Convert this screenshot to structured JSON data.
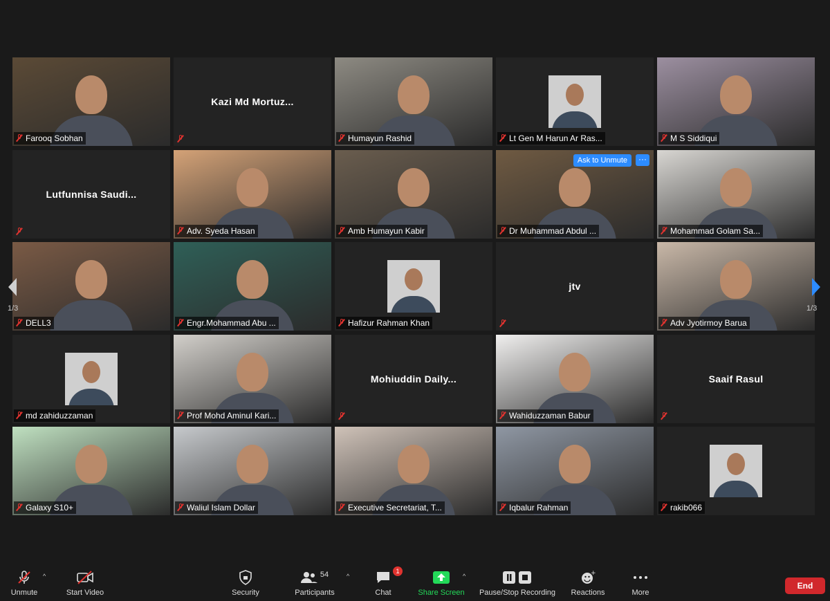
{
  "tiles": [
    {
      "name": "Farooq Sobhan",
      "type": "video",
      "bg": "#5b4a36"
    },
    {
      "name": "Kazi Md Mortuz...",
      "type": "name-only"
    },
    {
      "name": "Humayun Rashid",
      "type": "video",
      "bg": "#8d8a82"
    },
    {
      "name": "Lt Gen M Harun Ar Ras...",
      "type": "photo"
    },
    {
      "name": "M S Siddiqui",
      "type": "video",
      "bg": "#9c8fa0"
    },
    {
      "name": "Lutfunnisa Saudi...",
      "type": "name-only"
    },
    {
      "name": "Adv. Syeda Hasan",
      "type": "video",
      "bg": "#d4a277"
    },
    {
      "name": "Amb Humayun Kabir",
      "type": "video",
      "bg": "#6a5d4e"
    },
    {
      "name": "Dr Muhammad Abdul ...",
      "type": "video",
      "bg": "#6f5a42"
    },
    {
      "name": "Mohammad Golam Sa...",
      "type": "video",
      "bg": "#d8d6d2"
    },
    {
      "name": "DELL3",
      "type": "video",
      "bg": "#7a5a45"
    },
    {
      "name": "Engr.Mohammad Abu ...",
      "type": "video",
      "bg": "#2f5f57"
    },
    {
      "name": "Hafizur Rahman Khan",
      "type": "photo"
    },
    {
      "name": "jtv",
      "type": "name-only"
    },
    {
      "name": "Adv Jyotirmoy Barua",
      "type": "video",
      "bg": "#c9b8a8"
    },
    {
      "name": "md zahiduzzaman",
      "type": "photo"
    },
    {
      "name": "Prof Mohd Aminul Kari...",
      "type": "video",
      "bg": "#d2cfca"
    },
    {
      "name": "Mohiuddin Daily...",
      "type": "name-only"
    },
    {
      "name": "Wahiduzzaman Babur",
      "type": "video",
      "bg": "#f0efee"
    },
    {
      "name": "Saaif Rasul",
      "type": "name-only"
    },
    {
      "name": "Galaxy S10+",
      "type": "video",
      "bg": "#bfe0c0"
    },
    {
      "name": "Waliul Islam Dollar",
      "type": "video",
      "bg": "#c6c9cc"
    },
    {
      "name": "Executive Secretariat, T...",
      "type": "video",
      "bg": "#cfc2b8"
    },
    {
      "name": "Iqbalur Rahman",
      "type": "video",
      "bg": "#8f97a3"
    },
    {
      "name": "rakib066",
      "type": "photo"
    }
  ],
  "overlay": {
    "ask_to_unmute": "Ask to Unmute",
    "more": "···"
  },
  "pagination": {
    "left": "1/3",
    "right": "1/3"
  },
  "toolbar": {
    "unmute": "Unmute",
    "start_video": "Start Video",
    "security": "Security",
    "participants": "Participants",
    "participants_count": "54",
    "chat": "Chat",
    "chat_badge": "1",
    "share_screen": "Share Screen",
    "recording": "Pause/Stop Recording",
    "reactions": "Reactions",
    "more": "More",
    "end": "End"
  },
  "colors": {
    "accent_blue": "#2d8cff",
    "share_green": "#23d959",
    "end_red": "#d1282c",
    "active_speaker": "#d9e24a",
    "muted_red": "#e0332f"
  }
}
